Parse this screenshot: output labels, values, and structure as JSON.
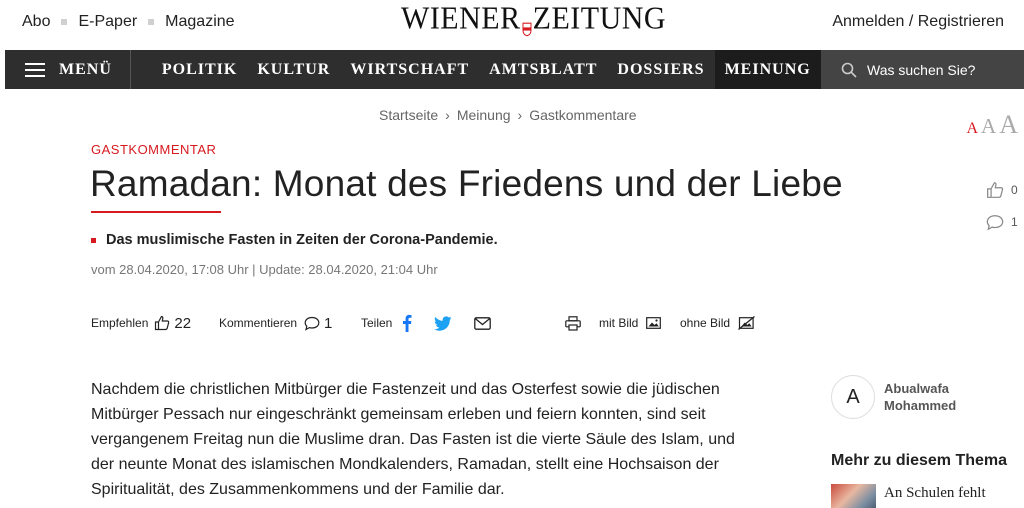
{
  "topbar": {
    "links": [
      "Abo",
      "E-Paper",
      "Magazine"
    ],
    "logo_left": "WIENER",
    "logo_right": "ZEITUNG",
    "auth": "Anmelden / Registrieren"
  },
  "nav": {
    "menu_label": "MENÜ",
    "items": [
      "POLITIK",
      "KULTUR",
      "WIRTSCHAFT",
      "AMTSBLATT",
      "DOSSIERS",
      "MEINUNG"
    ],
    "active": "MEINUNG",
    "search_placeholder": "Was suchen Sie?"
  },
  "breadcrumb": [
    "Startseite",
    "Meinung",
    "Gastkommentare"
  ],
  "font_size_controls": [
    "A",
    "A",
    "A"
  ],
  "article": {
    "kicker": "GASTKOMMENTAR",
    "headline": "Ramadan: Monat des Friedens und der Liebe",
    "lead": "Das muslimische Fasten in Zeiten der Corona-Pandemie.",
    "dateline": "vom 28.04.2020, 17:08 Uhr | Update: 28.04.2020, 21:04 Uhr",
    "actions": {
      "recommend_label": "Empfehlen",
      "recommend_count": "22",
      "comment_label": "Kommentieren",
      "comment_count": "1",
      "share_label": "Teilen",
      "with_image_label": "mit Bild",
      "without_image_label": "ohne Bild"
    },
    "body": "Nachdem die christlichen Mitbürger die Fastenzeit und das Osterfest sowie die jüdischen Mitbürger Pessach nur eingeschränkt gemeinsam erleben und feiern konnten, sind seit vergangenem Freitag nun die Muslime dran. Das Fasten ist die vierte Säule des Islam, und der neunte Monat des islamischen Mondkalenders, Ramadan, stellt eine Hochsaison der Spiritualität, des Zusammenkommens und der Familie dar."
  },
  "social": {
    "likes": "0",
    "comments": "1"
  },
  "author": {
    "initial": "A",
    "name": "Abualwafa Mohammed"
  },
  "related": {
    "title": "Mehr zu diesem Thema",
    "items": [
      "An Schulen fehlt"
    ]
  },
  "colors": {
    "accent": "#d71920",
    "nav_bg": "#2e2e2e",
    "nav_active_bg": "#1c1c1c",
    "search_bg": "#444444",
    "facebook": "#1877f2",
    "twitter": "#1da1f2"
  }
}
